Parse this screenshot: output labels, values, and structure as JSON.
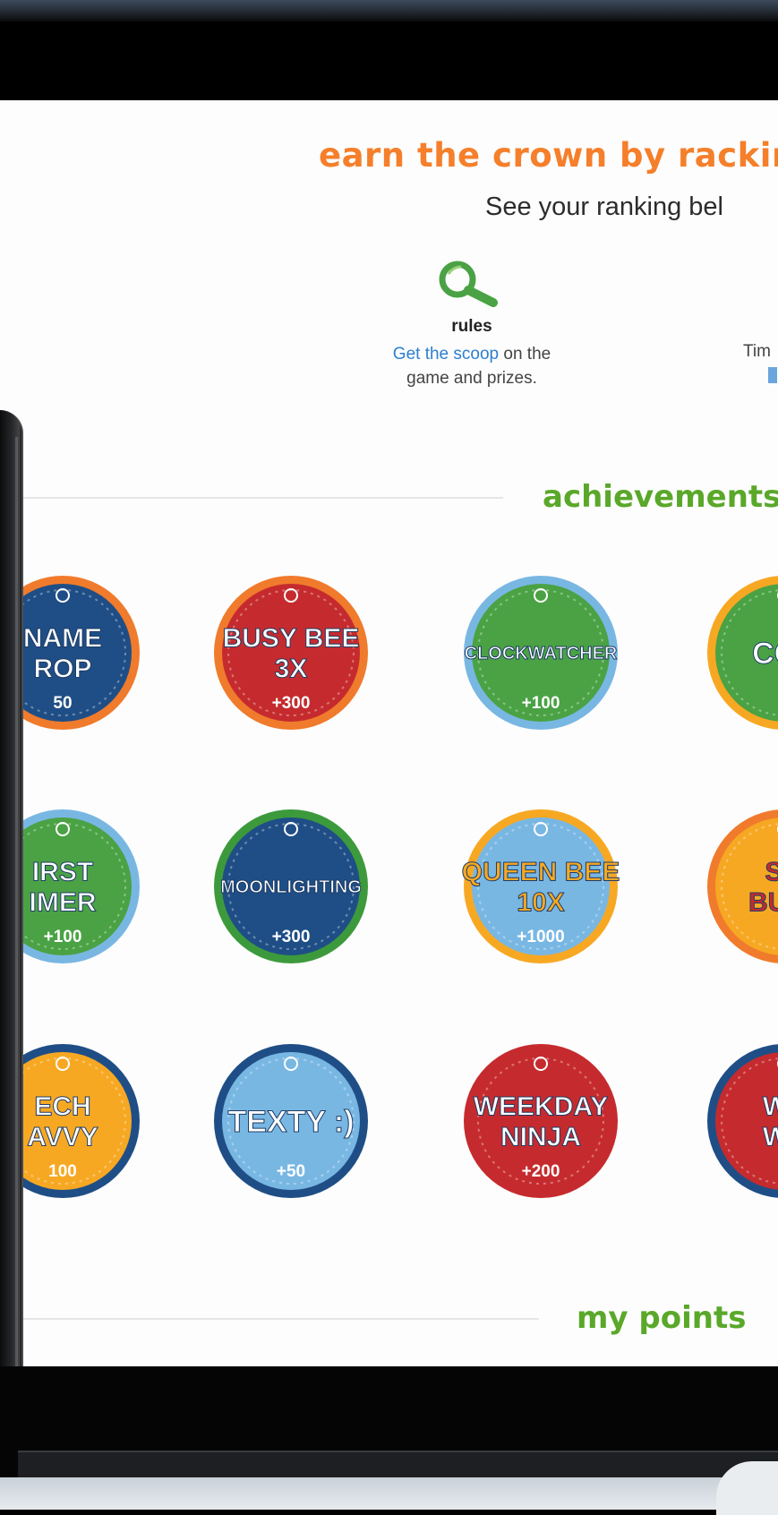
{
  "header": {
    "headline": "earn the crown by rackin",
    "subline": "See your ranking bel"
  },
  "rules": {
    "title": "rules",
    "link_text": "Get the scoop",
    "desc_rest": " on the",
    "desc_line2": "game and prizes."
  },
  "timing": {
    "text": "Tim"
  },
  "sections": {
    "achievements": "achievements",
    "points": "my points"
  },
  "badges": [
    {
      "name": "name-drop",
      "lines": [
        "NAME",
        "ROP"
      ],
      "points": "50",
      "ring": "#f07b2c",
      "fill": "#1f4e86",
      "text": "#ffffff"
    },
    {
      "name": "busy-bee",
      "lines": [
        "BUSY BEE",
        "3X"
      ],
      "points": "+300",
      "ring": "#f07b2c",
      "fill": "#c52b2e",
      "text": "#ffffff"
    },
    {
      "name": "clockwatcher",
      "lines": [
        "CLOCKWATCHER"
      ],
      "points": "+100",
      "ring": "#79b7e3",
      "fill": "#4aa244",
      "text": "#ffffff"
    },
    {
      "name": "col",
      "lines": [
        "COL"
      ],
      "points": "",
      "ring": "#f7a823",
      "fill": "#4aa244",
      "text": "#ffffff"
    },
    {
      "name": "first-timer",
      "lines": [
        "IRST",
        "IMER"
      ],
      "points": "+100",
      "ring": "#79b7e3",
      "fill": "#4aa244",
      "text": "#ffffff"
    },
    {
      "name": "moonlighting",
      "lines": [
        "MOONLIGHTING"
      ],
      "points": "+300",
      "ring": "#3c9a3c",
      "fill": "#1f4e86",
      "text": "#ffffff"
    },
    {
      "name": "queen-bee",
      "lines": [
        "QUEEN BEE",
        "10X"
      ],
      "points": "+1000",
      "ring": "#f7a823",
      "fill": "#79b7e3",
      "text": "#f7a823"
    },
    {
      "name": "social-butterfly",
      "lines": [
        "SO",
        "BUTT"
      ],
      "points": "",
      "ring": "#f07b2c",
      "fill": "#f7a823",
      "text": "#c52b2e"
    },
    {
      "name": "tech-savvy",
      "lines": [
        "ECH",
        "AVVY"
      ],
      "points": "100",
      "ring": "#1f4e86",
      "fill": "#f7a823",
      "text": "#ffffff"
    },
    {
      "name": "texty",
      "lines": [
        "TEXTY :)"
      ],
      "points": "+50",
      "ring": "#1f4e86",
      "fill": "#79b7e3",
      "text": "#ffffff"
    },
    {
      "name": "weekday-ninja",
      "lines": [
        "WEEKDAY",
        "NINJA"
      ],
      "points": "+200",
      "ring": "#c52b2e",
      "fill": "#c52b2e",
      "text": "#ffffff"
    },
    {
      "name": "weekend-warrior",
      "lines": [
        "WE",
        "WA"
      ],
      "points": "",
      "ring": "#1f4e86",
      "fill": "#c52b2e",
      "text": "#ffffff"
    }
  ]
}
